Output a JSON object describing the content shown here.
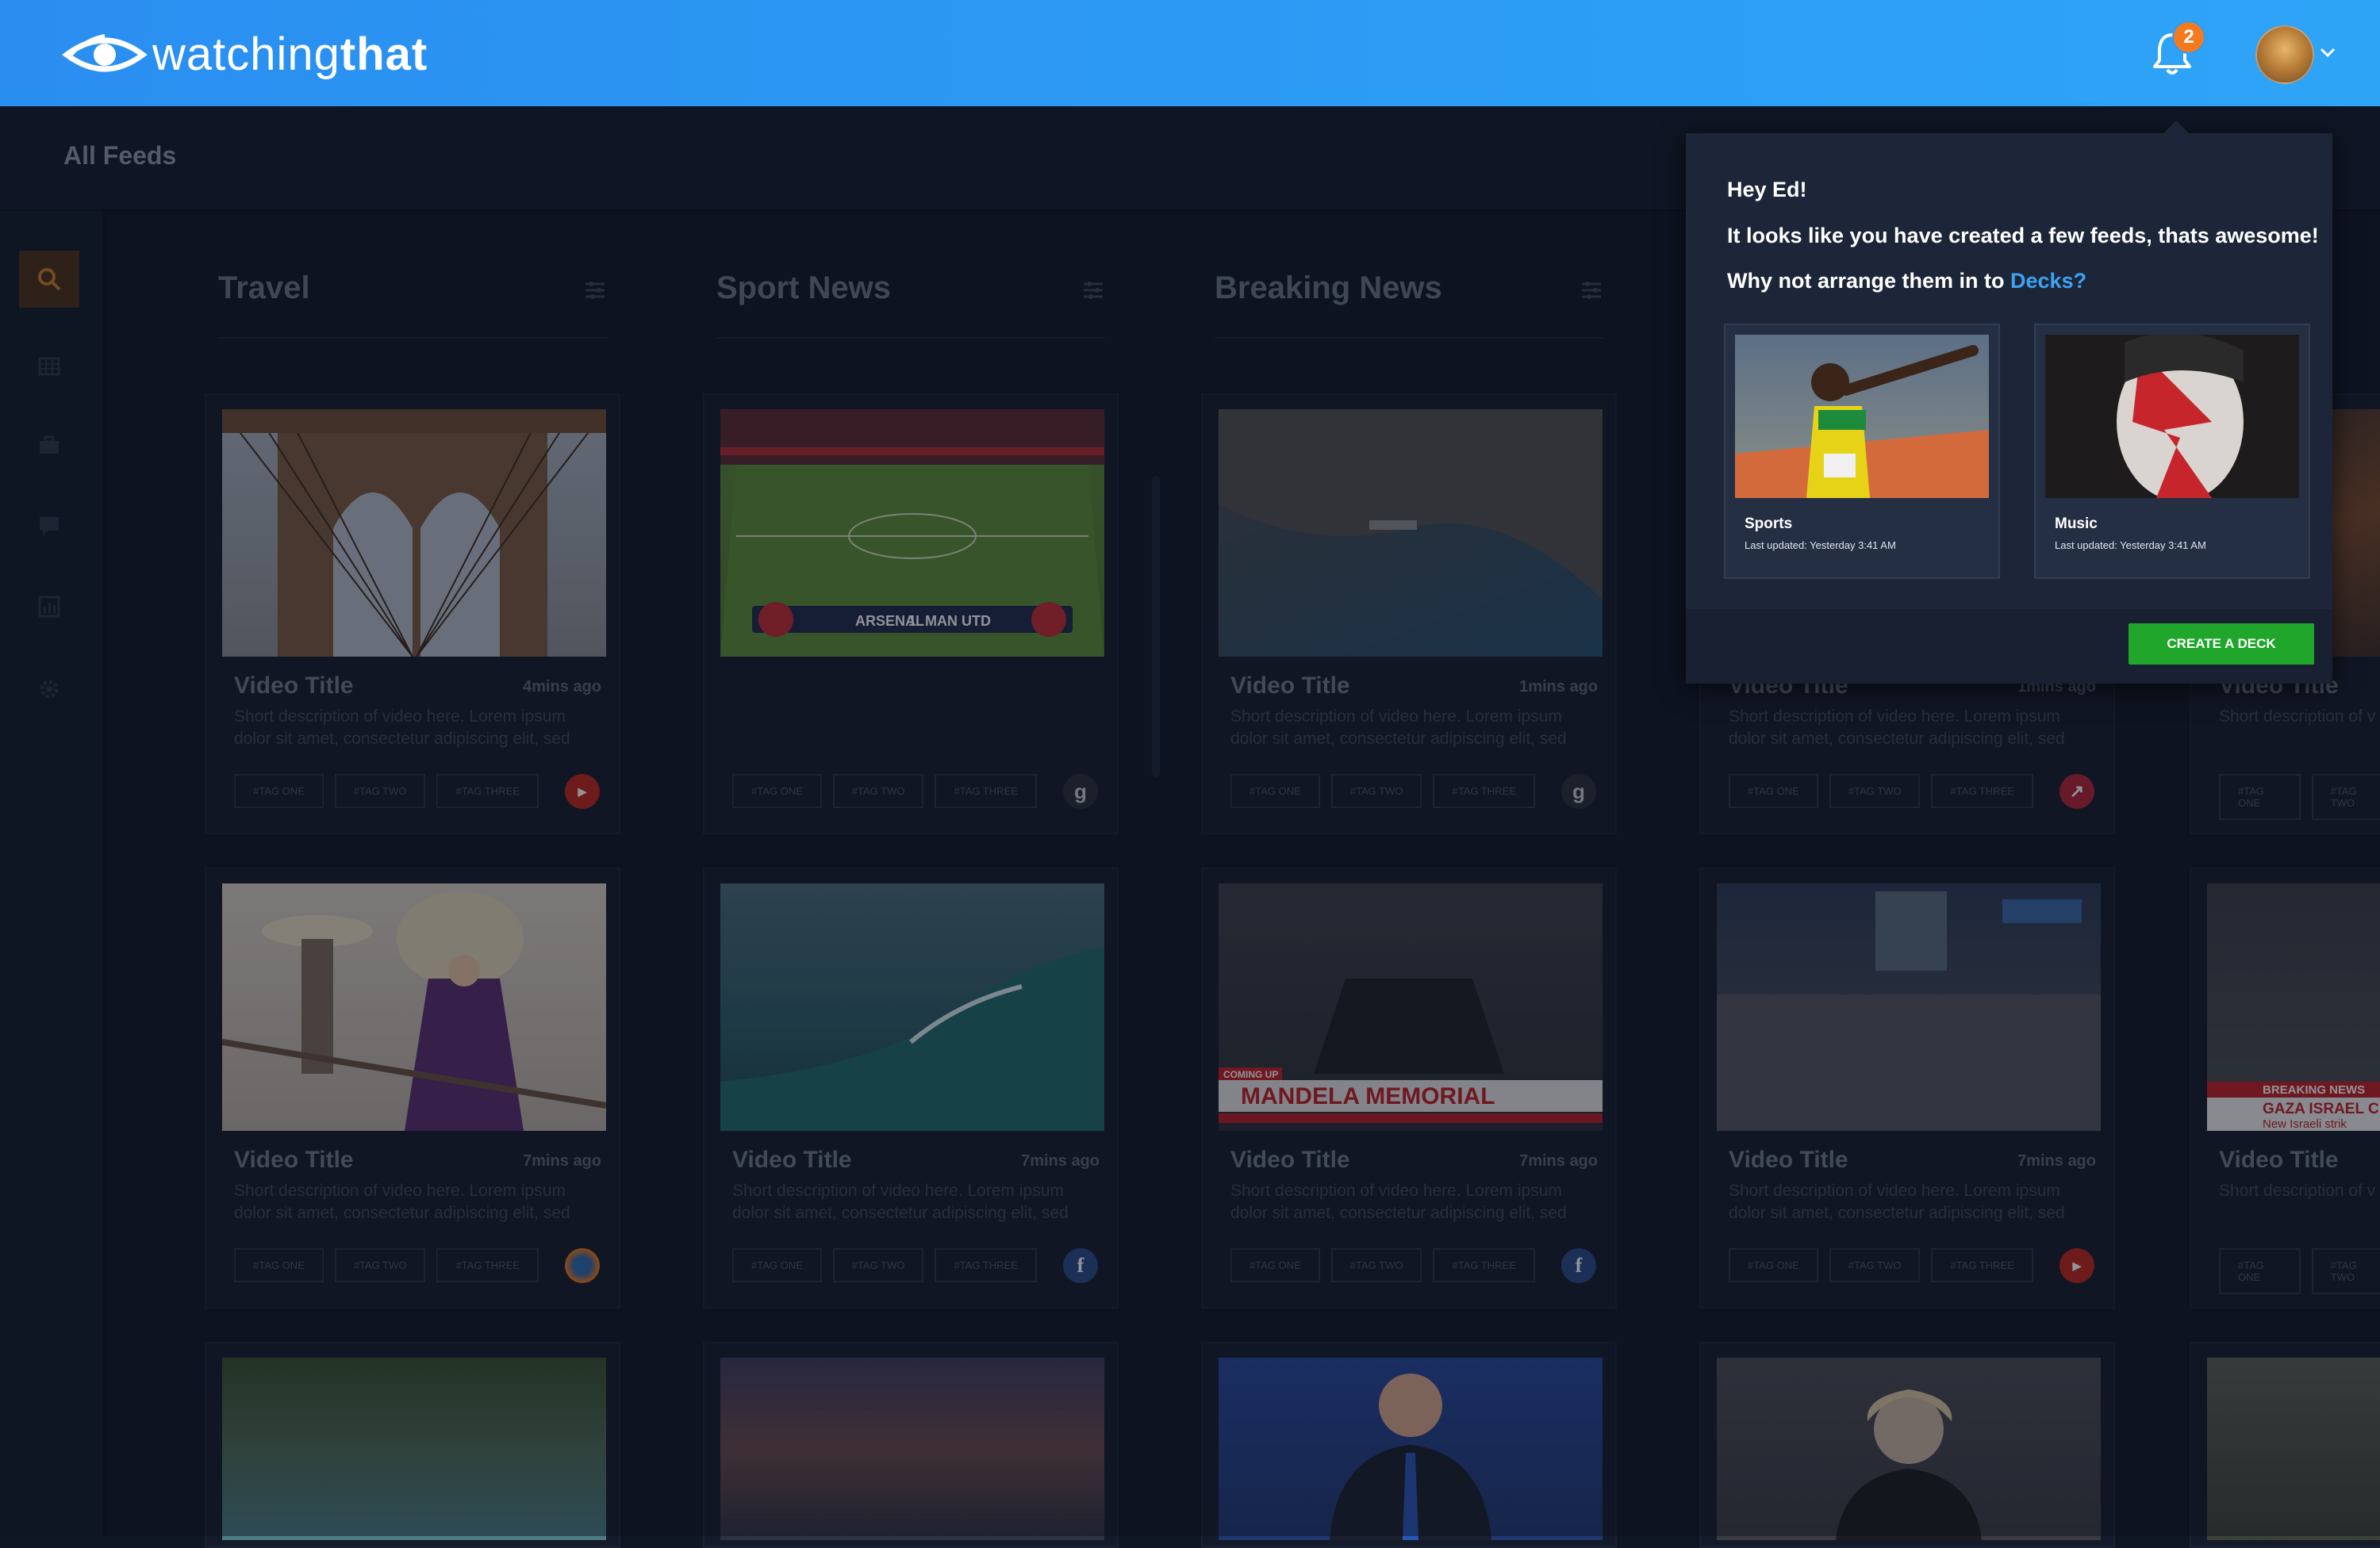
{
  "app": {
    "logo_part1": "watching",
    "logo_part2": "that",
    "notification_count": "2",
    "colors": {
      "topbar": "#2c9cf5",
      "accent": "#3da2f5",
      "cta": "#1fa62b",
      "badge": "#f47a20"
    }
  },
  "page": {
    "title": "All Feeds"
  },
  "sidebar": {
    "items": [
      {
        "icon": "search-icon",
        "active": true
      },
      {
        "icon": "grid-icon"
      },
      {
        "icon": "briefcase-icon"
      },
      {
        "icon": "chat-icon"
      },
      {
        "icon": "bar-chart-icon"
      },
      {
        "icon": "gear-icon"
      }
    ]
  },
  "columns": [
    {
      "name": "Travel"
    },
    {
      "name": "Sport News"
    },
    {
      "name": "Breaking News"
    }
  ],
  "cards": [
    {
      "title": "Video Title",
      "ago": "4mins ago",
      "desc": "Short description of video here. Lorem ipsum dolor sit amet, consectetur adipiscing elit, sed",
      "tags": [
        "#TAG ONE",
        "#TAG TWO",
        "#TAG THREE"
      ],
      "source": "youtube-icon"
    },
    {
      "title": "",
      "ago": "",
      "desc": "",
      "tags": [
        "#TAG ONE",
        "#TAG TWO",
        "#TAG THREE"
      ],
      "source": "g-source-icon"
    },
    {
      "title": "Video Title",
      "ago": "1mins ago",
      "desc": "Short description of video here. Lorem ipsum dolor sit amet, consectetur adipiscing elit, sed",
      "tags": [
        "#TAG ONE",
        "#TAG TWO",
        "#TAG THREE"
      ],
      "source": "g-source-icon"
    },
    {
      "title": "Video Title",
      "ago": "1mins ago",
      "desc": "Short description of video here. Lorem ipsum dolor sit amet, consectetur adipiscing elit, sed",
      "tags": [
        "#TAG ONE",
        "#TAG TWO",
        "#TAG THREE"
      ],
      "source": "trending-icon"
    },
    {
      "title": "Video Title",
      "ago": "",
      "desc": "Short description of v",
      "tags": [
        "#TAG ONE",
        "#TAG TWO"
      ],
      "source": ""
    },
    {
      "title": "Video Title",
      "ago": "7mins ago",
      "desc": "Short description of video here. Lorem ipsum dolor sit amet, consectetur adipiscing elit, sed",
      "tags": [
        "#TAG ONE",
        "#TAG TWO",
        "#TAG THREE"
      ],
      "source": "firefox-icon"
    },
    {
      "title": "Video Title",
      "ago": "7mins ago",
      "desc": "Short description of video here. Lorem ipsum dolor sit amet, consectetur adipiscing elit, sed",
      "tags": [
        "#TAG ONE",
        "#TAG TWO",
        "#TAG THREE"
      ],
      "source": "facebook-icon"
    },
    {
      "title": "Video Title",
      "ago": "7mins ago",
      "desc": "Short description of video here. Lorem ipsum dolor sit amet, consectetur adipiscing elit, sed",
      "tags": [
        "#TAG ONE",
        "#TAG TWO",
        "#TAG THREE"
      ],
      "source": "facebook-icon",
      "overlay_text": "MANDELA MEMORIAL",
      "overlay_small": "COMING UP"
    },
    {
      "title": "Video Title",
      "ago": "7mins ago",
      "desc": "Short description of video here. Lorem ipsum dolor sit amet, consectetur adipiscing elit, sed",
      "tags": [
        "#TAG ONE",
        "#TAG TWO",
        "#TAG THREE"
      ],
      "source": "youtube-icon"
    },
    {
      "title": "Video Title",
      "ago": "",
      "desc": "Short description of v",
      "tags": [
        "#TAG ONE",
        "#TAG TWO"
      ],
      "source": "",
      "overlay_text": "BREAKING NEWS",
      "overlay_sub": "GAZA ISRAEL C",
      "overlay_sub2": "New Israeli strik"
    }
  ],
  "popup": {
    "greeting": "Hey Ed!",
    "message": "It looks like you have created a few feeds, thats awesome!",
    "prompt": "Why not arrange them in to",
    "link": "Decks?",
    "decks": [
      {
        "name": "Sports",
        "updated": "Last updated: Yesterday 3:41 AM"
      },
      {
        "name": "Music",
        "updated": "Last updated: Yesterday 3:41 AM"
      }
    ],
    "cta": "CREATE A DECK"
  },
  "scoreboard": {
    "home": "ARSENAL",
    "away": "MAN UTD",
    "score": "1"
  }
}
